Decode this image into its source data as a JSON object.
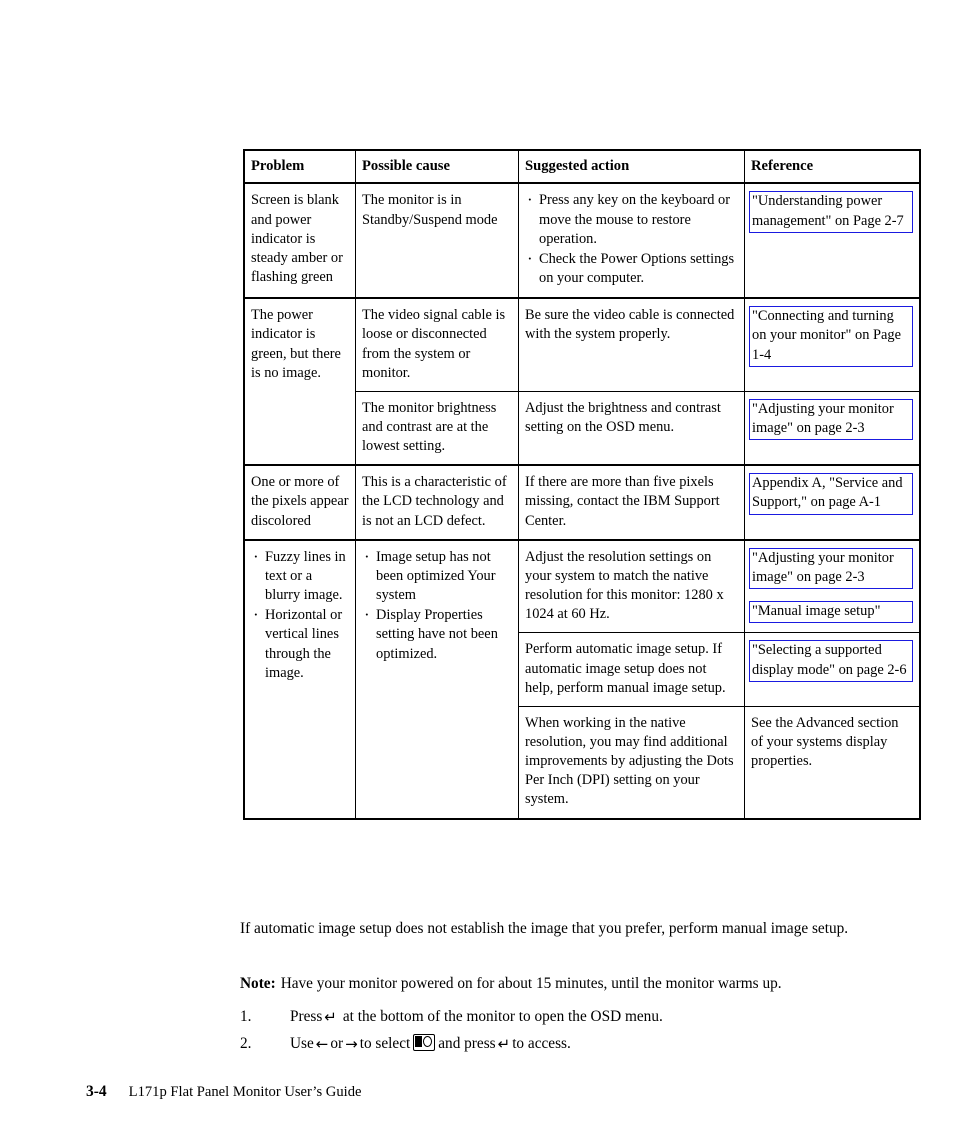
{
  "table": {
    "headers": [
      "Problem",
      "Possible cause",
      "Suggested action",
      "Reference"
    ],
    "rows": [
      {
        "problem": "Screen is blank and power indicator is steady amber or flashing green",
        "cause": "The monitor is in Standby/Suspend mode",
        "action_bullets": [
          "Press any key on the keyboard or move the mouse to restore operation.",
          "Check the Power Options settings on your computer."
        ],
        "references": [
          "\"Understanding power management\" on  Page 2-7"
        ]
      },
      {
        "problem": "The power indicator is green, but there is no image.",
        "cause": "The video signal cable is loose or disconnected from the system or monitor.",
        "action": "Be sure the video cable is connected with the system properly.",
        "references": [
          "\"Connecting and turning on your monitor\" on Page 1-4"
        ]
      },
      {
        "cause": "The monitor brightness and contrast are at the lowest setting.",
        "action": "Adjust the brightness and contrast setting on the OSD menu.",
        "references": [
          "\"Adjusting your monitor image\" on page 2-3"
        ]
      },
      {
        "problem": "One or more of the pixels appear discolored",
        "cause": "This is a characteristic of the LCD technology and is not an LCD defect.",
        "action": "If there are more than five pixels missing, contact the IBM Support Center.",
        "references": [
          "Appendix A, \"Service and Support,\" on page A-1"
        ]
      },
      {
        "problem_bullets": [
          "Fuzzy lines in text or a blurry image.",
          "Horizontal or vertical lines through the image."
        ],
        "cause_bullets": [
          "Image setup has not been optimized Your system",
          "Display Properties setting have not been optimized."
        ],
        "action": "Adjust the resolution settings on your system to match the native resolution for this monitor: 1280 x 1024 at 60 Hz.",
        "references": [
          "\"Adjusting your monitor image\" on page 2-3",
          "\"Manual image setup\""
        ]
      },
      {
        "action": "Perform automatic image setup. If automatic image setup does not help, perform manual image setup.",
        "references": [
          "\"Selecting a supported display mode\" on page 2-6"
        ]
      },
      {
        "action": "When working in the native resolution, you may find additional improvements by adjusting the Dots Per Inch (DPI) setting on your system.",
        "reference_plain": "See the Advanced section of your systems display properties."
      }
    ]
  },
  "body": {
    "intro": "If automatic image setup does not establish the image that you prefer, perform manual image setup.",
    "note_label": "Note:",
    "note_text": "Have your monitor powered on for about 15 minutes, until the monitor warms up."
  },
  "steps": [
    {
      "number": "1.",
      "part1": "Press",
      "glyph": "↵",
      "glyph_name": "enter-key-icon",
      "part2": "at the bottom of the monitor to open the OSD menu."
    },
    {
      "number": "2.",
      "part1": "Use",
      "glyph_left": "←",
      "mid1": "or",
      "glyph_right": "→",
      "mid2": "to select",
      "icon_name": "image-setup-osd-icon",
      "mid3": "and press",
      "glyph_enter": "↵",
      "part2": "to access."
    }
  ],
  "footer": {
    "page_number": "3-4",
    "title": "L171p Flat Panel Monitor User’s Guide"
  },
  "colors": {
    "link_border": "#1a1ae0",
    "text": "#000000",
    "background": "#ffffff"
  }
}
